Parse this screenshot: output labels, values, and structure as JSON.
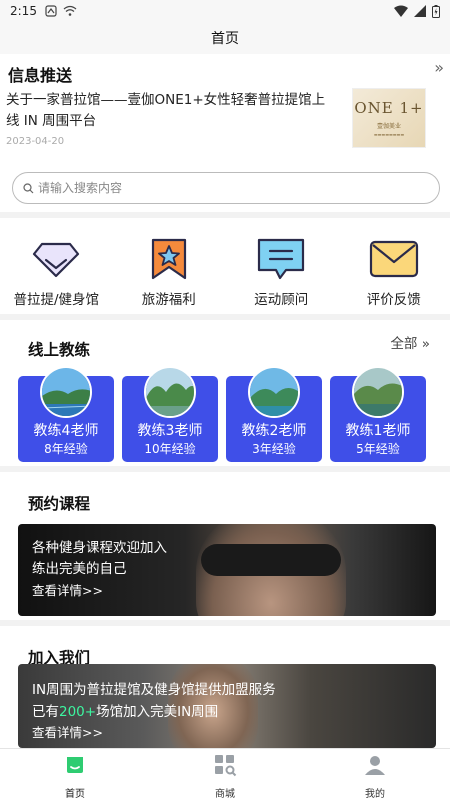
{
  "status_bar": {
    "time": "2:15"
  },
  "header": {
    "title": "首页"
  },
  "news": {
    "heading": "信息推送",
    "more": "»",
    "article_title": "关于一家普拉馆——壹伽ONE1+女性轻奢普拉提馆上线 IN 周围平台",
    "article_date": "2023-04-20",
    "thumb_logo": "ONE 1+",
    "thumb_sub": "壹伽美业"
  },
  "search": {
    "placeholder": "请输入搜索内容"
  },
  "categories": [
    {
      "label": "普拉提/健身馆",
      "icon": "diamond-icon"
    },
    {
      "label": "旅游福利",
      "icon": "star-bookmark-icon"
    },
    {
      "label": "运动顾问",
      "icon": "chat-bubble-icon"
    },
    {
      "label": "评价反馈",
      "icon": "envelope-icon"
    }
  ],
  "coaches": {
    "heading": "线上教练",
    "all_label": "全部 »",
    "items": [
      {
        "name": "教练4老师",
        "experience": "8年经验"
      },
      {
        "name": "教练3老师",
        "experience": "10年经验"
      },
      {
        "name": "教练2老师",
        "experience": "3年经验"
      },
      {
        "name": "教练1老师",
        "experience": "5年经验"
      }
    ]
  },
  "course": {
    "heading": "预约课程",
    "line1": "各种健身课程欢迎加入",
    "line2": "练出完美的自己",
    "line3": "查看详情>>"
  },
  "join": {
    "heading": "加入我们",
    "line1": "IN周围为普拉提馆及健身馆提供加盟服务",
    "line2_prefix": "已有",
    "line2_highlight": "200+",
    "line2_suffix": "场馆加入完美IN周围",
    "line3": "查看详情>>"
  },
  "tabbar": [
    {
      "label": "首页",
      "icon": "home-icon",
      "active": true
    },
    {
      "label": "商城",
      "icon": "grid-search-icon",
      "active": false
    },
    {
      "label": "我的",
      "icon": "user-icon",
      "active": false
    }
  ],
  "colors": {
    "coach_card": "#3f4fe8",
    "accent_green": "#2ecc71",
    "highlight_green": "#3df5a0"
  }
}
